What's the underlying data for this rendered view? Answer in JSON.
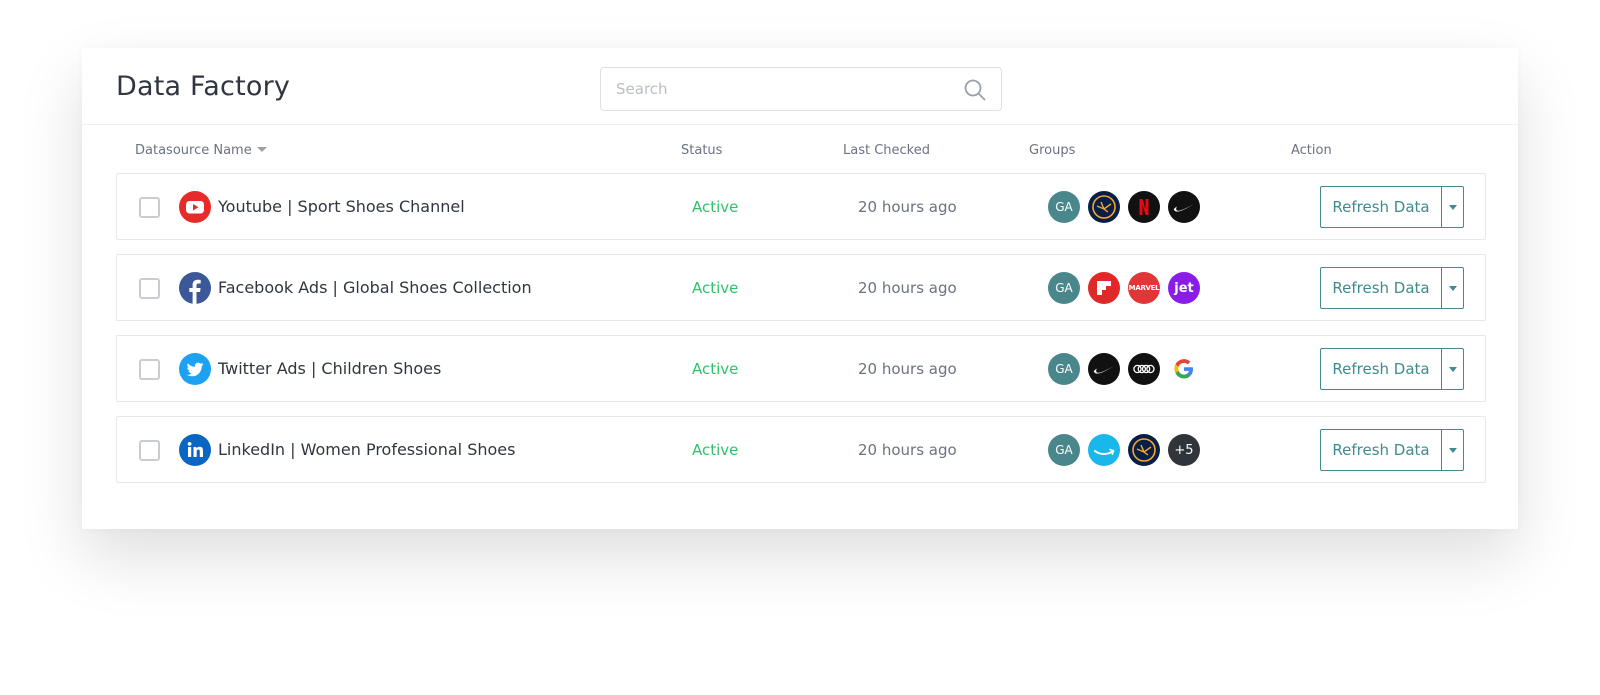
{
  "header": {
    "title": "Data Factory",
    "search_placeholder": "Search"
  },
  "columns": {
    "name": "Datasource Name",
    "status": "Status",
    "last_checked": "Last Checked",
    "groups": "Groups",
    "action": "Action"
  },
  "colors": {
    "accent": "#3f8b8f",
    "active": "#2ec36a",
    "ga_badge": "#4a878c"
  },
  "rows": [
    {
      "name": "Youtube | Sport Shoes Channel",
      "source_icon": "youtube-icon",
      "status": "Active",
      "last_checked": "20 hours ago",
      "groups": [
        "GA",
        "lufthansa-icon",
        "netflix-icon",
        "nike-icon"
      ],
      "action_label": "Refresh Data"
    },
    {
      "name": "Facebook Ads | Global Shoes Collection",
      "source_icon": "facebook-icon",
      "status": "Active",
      "last_checked": "20 hours ago",
      "groups": [
        "GA",
        "flipboard-icon",
        "MARVEL",
        "jet"
      ],
      "action_label": "Refresh Data"
    },
    {
      "name": "Twitter Ads | Children Shoes",
      "source_icon": "twitter-icon",
      "status": "Active",
      "last_checked": "20 hours ago",
      "groups": [
        "GA",
        "nike-icon",
        "audi-icon",
        "google-icon"
      ],
      "action_label": "Refresh Data"
    },
    {
      "name": "LinkedIn | Women Professional Shoes",
      "source_icon": "linkedin-icon",
      "status": "Active",
      "last_checked": "20 hours ago",
      "groups": [
        "GA",
        "amazon-icon",
        "lufthansa-icon",
        "+5"
      ],
      "action_label": "Refresh Data"
    }
  ]
}
